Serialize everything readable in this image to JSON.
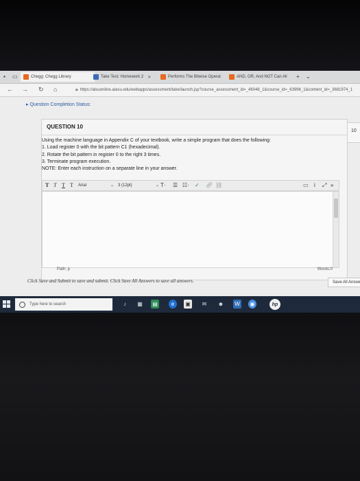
{
  "browser": {
    "tabs": [
      {
        "label": "Chegg: Chegg Library",
        "color": "#e66a1f"
      },
      {
        "label": "Take Test: Homework 2",
        "color": "#3d6cb3"
      },
      {
        "label": "Performs The Bitwise Operat",
        "color": "#e66a1f"
      },
      {
        "label": "AND, OR, And NOT Can All",
        "color": "#e66a1f"
      }
    ],
    "url": "https://alsuonline.alasu.edu/webapps/assessment/take/launch.jsp?course_assessment_id=_46048_1&course_id=_63996_1&content_id=_3681974_1"
  },
  "status": {
    "label": "Question Completion Status:"
  },
  "question": {
    "title": "QUESTION 10",
    "points": "10",
    "lines": [
      "Using the machine language in Appendix C of your textbook, write a simple program that does the following:",
      "1. Load register 0 with the bit pattern C1 (hexadecimal).",
      "2. Rotate the bit pattern in register 0 to the right 3 times.",
      "3. Terminate program execution.",
      "NOTE: Enter each instruction on a separate line in your answer."
    ]
  },
  "editor": {
    "font_family": "Arial",
    "font_size": "3 (12pt)",
    "path_label": "Path: p",
    "words_label": "Words:0"
  },
  "footer": {
    "instructions": "Click Save and Submit to save and submit. Click Save All Answers to save all answers.",
    "save_all_label": "Save All Answers"
  },
  "taskbar": {
    "search_placeholder": "Type here to search"
  }
}
